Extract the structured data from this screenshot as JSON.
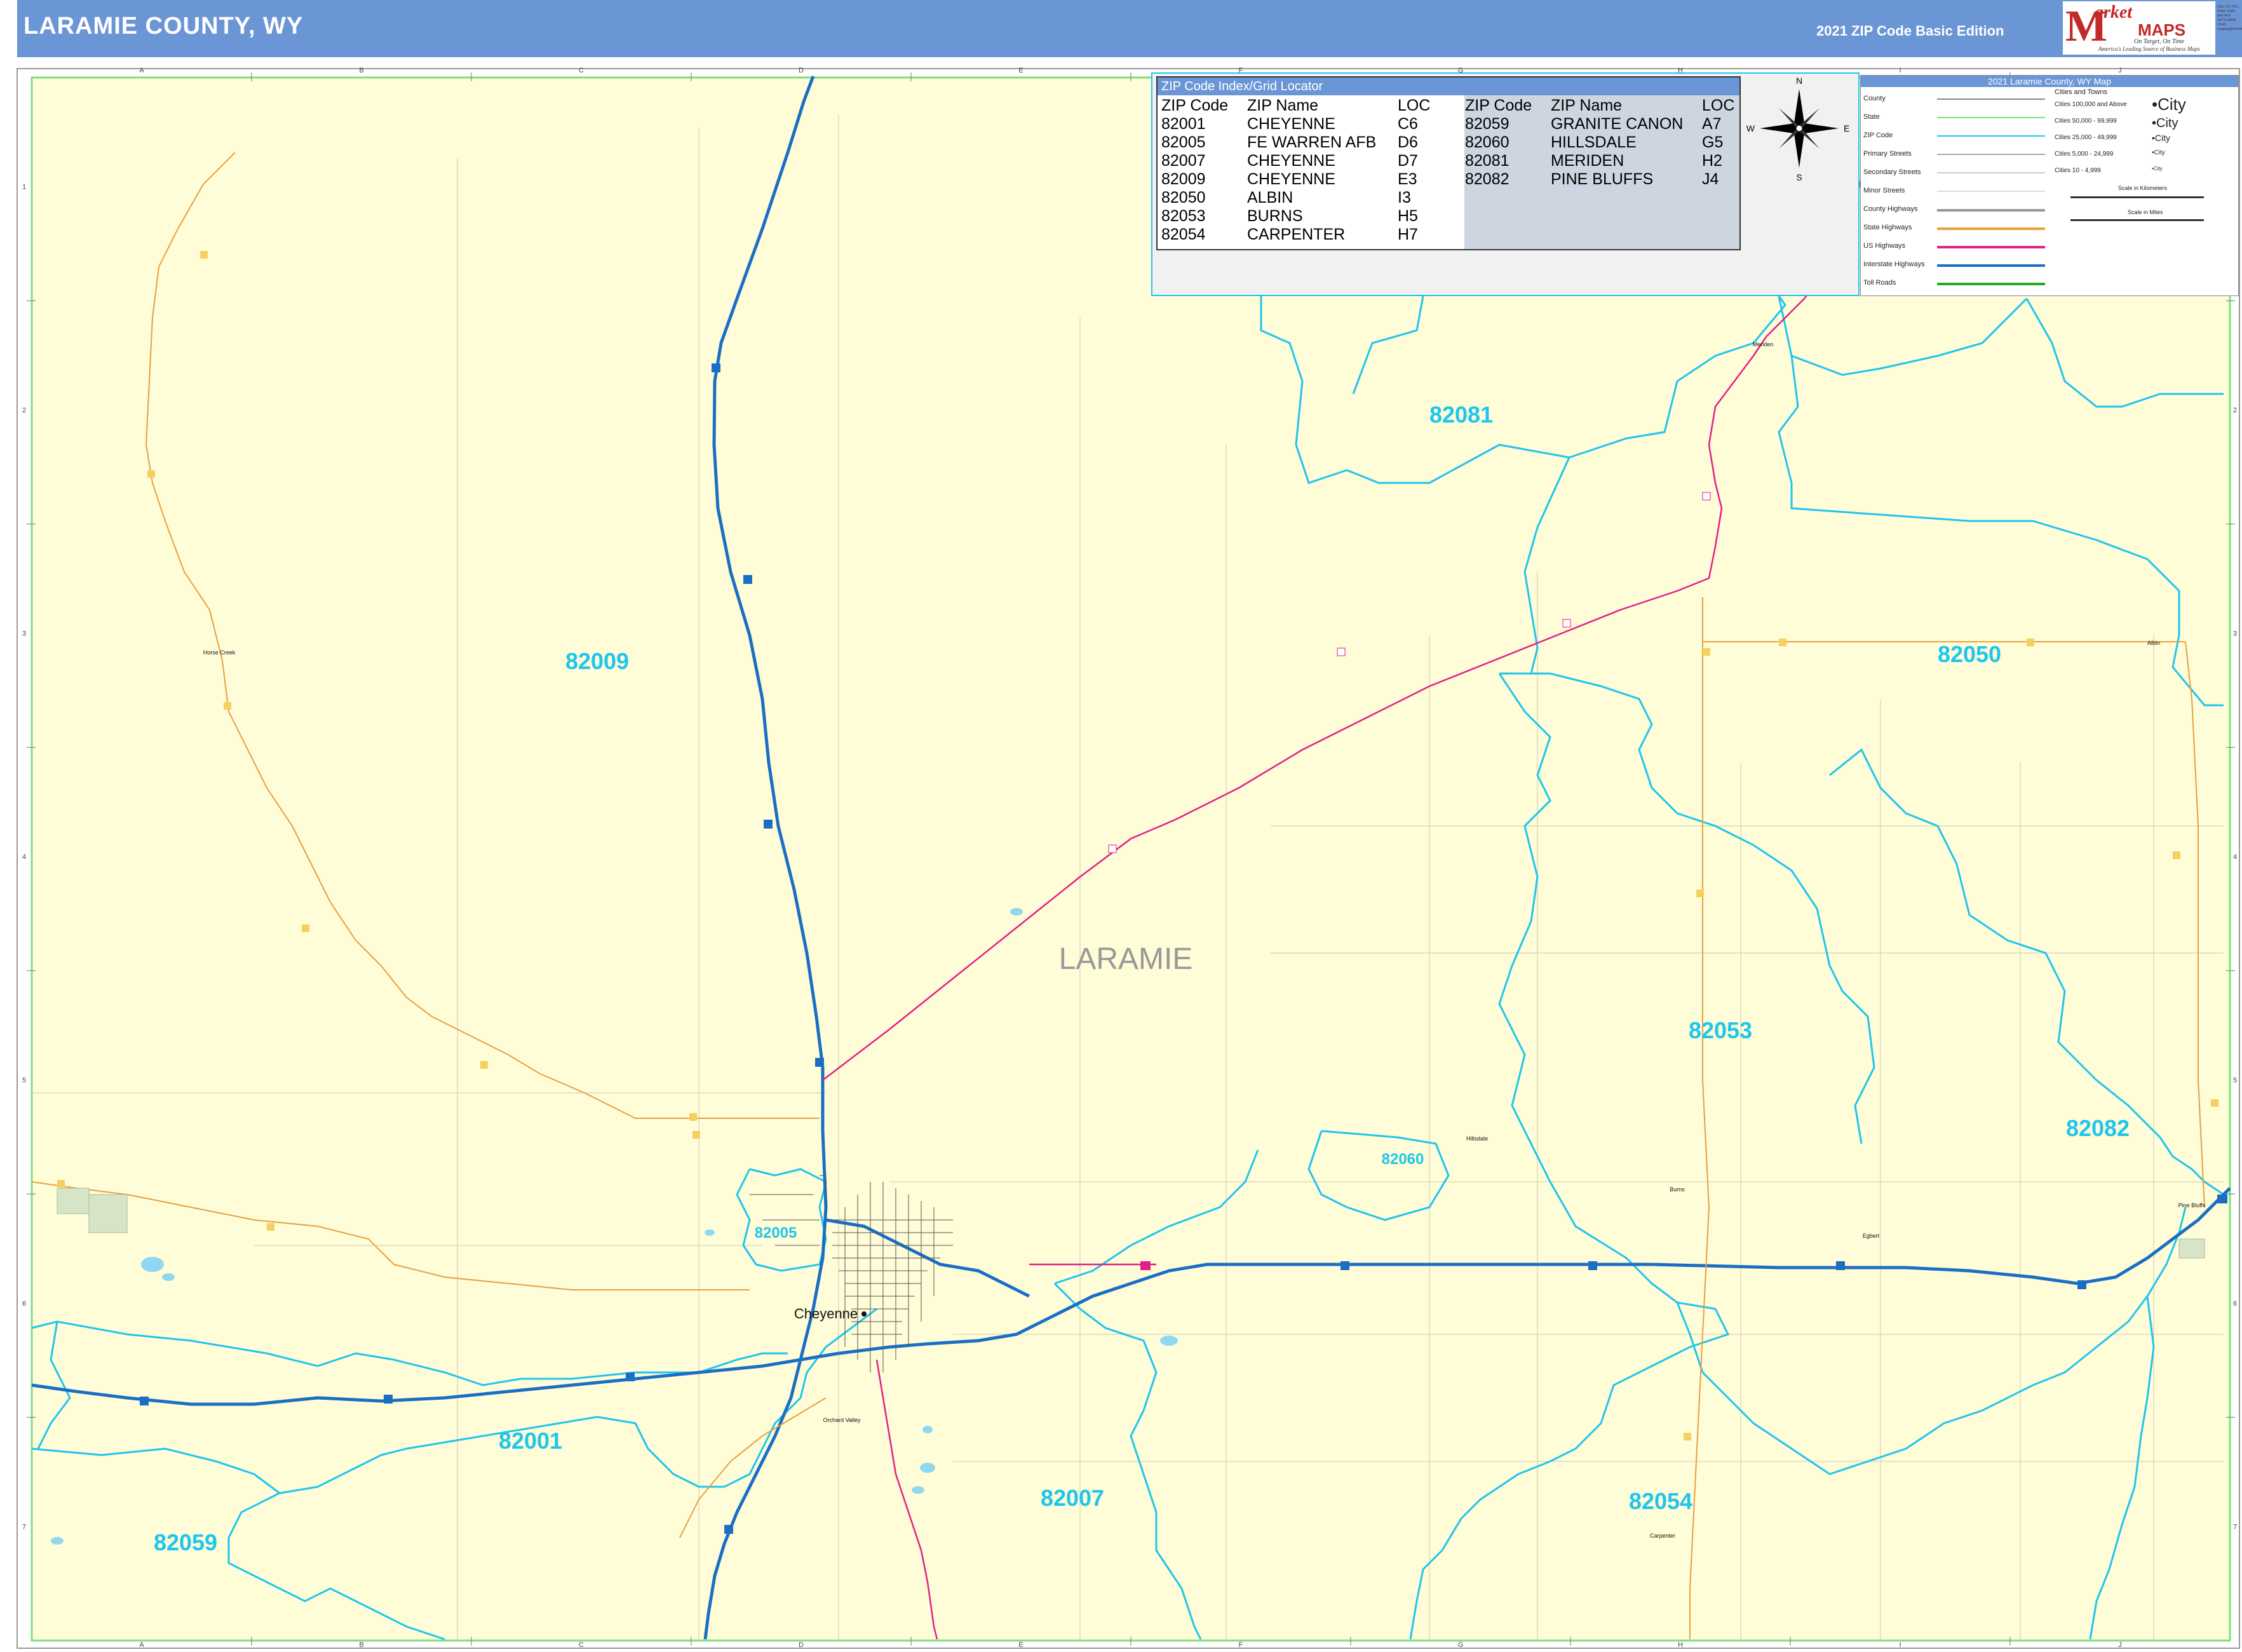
{
  "header": {
    "title": "LARAMIE COUNTY, WY",
    "edition": "2021 ZIP Code Basic Edition"
  },
  "logo": {
    "brand_top": "arket",
    "brand_bottom": "MAPS",
    "tagline1": "On Target, On Time",
    "tagline2": "America's Leading Source of Business Maps",
    "contact": "CALL US TOLL FREE 1-800-848-0475 (8477) EMAIL US AT: mapping@marketmaps.com"
  },
  "grid": {
    "columns": [
      "A",
      "B",
      "C",
      "D",
      "E",
      "F",
      "G",
      "H",
      "I",
      "J"
    ],
    "rows": [
      "1",
      "2",
      "3",
      "4",
      "5",
      "6",
      "7"
    ]
  },
  "zip_index": {
    "title": "ZIP Code Index/Grid Locator",
    "headers": [
      "ZIP Code",
      "ZIP Name",
      "LOC"
    ],
    "left": [
      [
        "82001",
        "CHEYENNE",
        "C6"
      ],
      [
        "82005",
        "FE WARREN AFB",
        "D6"
      ],
      [
        "82007",
        "CHEYENNE",
        "D7"
      ],
      [
        "82009",
        "CHEYENNE",
        "E3"
      ],
      [
        "82050",
        "ALBIN",
        "I3"
      ],
      [
        "82053",
        "BURNS",
        "H5"
      ],
      [
        "82054",
        "CARPENTER",
        "H7"
      ]
    ],
    "right": [
      [
        "82059",
        "GRANITE CANON",
        "A7"
      ],
      [
        "82060",
        "HILLSDALE",
        "G5"
      ],
      [
        "82081",
        "MERIDEN",
        "H2"
      ],
      [
        "82082",
        "PINE BLUFFS",
        "J4"
      ]
    ]
  },
  "compass": {
    "n": "N",
    "s": "S",
    "e": "E",
    "w": "W"
  },
  "legend": {
    "title": "2021 Laramie County, WY Map",
    "items": [
      {
        "label": "County",
        "color": "#888888"
      },
      {
        "label": "State",
        "color": "#7fe07f"
      },
      {
        "label": "ZIP Code",
        "color": "#1ec6ee"
      },
      {
        "label": "Primary Streets",
        "color": "#aaaaaa"
      },
      {
        "label": "Secondary Streets",
        "color": "#cccccc"
      },
      {
        "label": "Minor Streets",
        "color": "#dddddd"
      },
      {
        "label": "County Highways",
        "color": "#999999"
      },
      {
        "label": "State Highways",
        "color": "#e8a040"
      },
      {
        "label": "US Highways",
        "color": "#e0208a"
      },
      {
        "label": "Interstate Highways",
        "color": "#1a6fc4"
      },
      {
        "label": "Toll Roads",
        "color": "#22aa22"
      }
    ],
    "cities_title": "Cities and Towns",
    "cities": [
      {
        "label": "Cities 100,000 and Above",
        "sample": "•City"
      },
      {
        "label": "Cities 50,000 - 99,999",
        "sample": "•City"
      },
      {
        "label": "Cities 25,000 - 49,999",
        "sample": "•City"
      },
      {
        "label": "Cities 5,000 - 24,999",
        "sample": "•City"
      },
      {
        "label": "Cities 10 - 4,999",
        "sample": "•City"
      }
    ],
    "scale_km": "Scale in Kilometers",
    "scale_mi": "Scale in Miles"
  },
  "map": {
    "county_label": "LARAMIE",
    "partial_label": "N",
    "zips": [
      {
        "code": "82081"
      },
      {
        "code": "82009"
      },
      {
        "code": "82050"
      },
      {
        "code": "82053"
      },
      {
        "code": "82082"
      },
      {
        "code": "82060"
      },
      {
        "code": "82005"
      },
      {
        "code": "82001"
      },
      {
        "code": "82007"
      },
      {
        "code": "82054"
      },
      {
        "code": "82059"
      }
    ],
    "cities": [
      {
        "name": "Cheyenne"
      },
      {
        "name": "Horse Creek"
      },
      {
        "name": "Burns"
      },
      {
        "name": "Hillsdale"
      },
      {
        "name": "Carpenter"
      },
      {
        "name": "Pine Bluffs"
      },
      {
        "name": "Meriden"
      },
      {
        "name": "Albin"
      },
      {
        "name": "Egbert"
      },
      {
        "name": "Orchard Valley"
      }
    ]
  },
  "colors": {
    "land": "#fffcd8",
    "zip_line": "#1ec6ee",
    "interstate": "#1a6fc4",
    "us_highway": "#e0208a",
    "state_highway": "#e8a040",
    "county_border": "#7fe07f",
    "header": "#6b96d6"
  }
}
